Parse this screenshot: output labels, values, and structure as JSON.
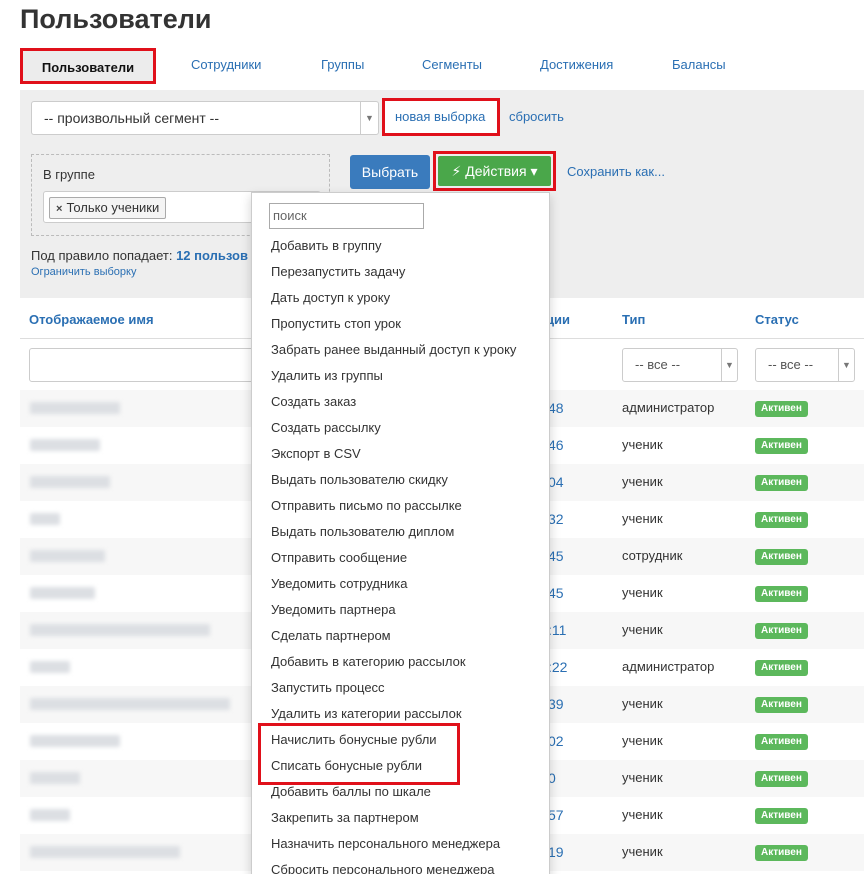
{
  "page": {
    "title": "Пользователи"
  },
  "tabs": [
    "Пользователи",
    "Сотрудники",
    "Группы",
    "Сегменты",
    "Достижения",
    "Балансы"
  ],
  "filter": {
    "segment_value": "-- произвольный сегмент --",
    "new_selection": "новая выборка",
    "reset": "сбросить",
    "group_label": "В группе",
    "group_tag": "Только ученики",
    "choose_button": "Выбрать",
    "actions_button": "Действия",
    "save_as": "Сохранить как...",
    "count_prefix": "Под правило попадает:",
    "count_value": "12 пользов",
    "limit": "Ограничить выборку"
  },
  "columns": {
    "name": "Отображаемое имя",
    "id_partial": "ции",
    "type": "Тип",
    "status": "Статус",
    "type_filter": "-- все --",
    "status_filter": "-- все --"
  },
  "rows": [
    {
      "id": "48",
      "type": "администратор",
      "status": "Активен"
    },
    {
      "id": "46",
      "type": "ученик",
      "status": "Активен"
    },
    {
      "id": "04",
      "type": "ученик",
      "status": "Активен"
    },
    {
      "id": "32",
      "type": "ученик",
      "status": "Активен"
    },
    {
      "id": "45",
      "type": "сотрудник",
      "status": "Активен"
    },
    {
      "id": "45",
      "type": "ученик",
      "status": "Активен"
    },
    {
      "id": ":11",
      "type": "ученик",
      "status": "Активен"
    },
    {
      "id": ":22",
      "type": "администратор",
      "status": "Активен"
    },
    {
      "id": "39",
      "type": "ученик",
      "status": "Активен"
    },
    {
      "id": "02",
      "type": "ученик",
      "status": "Активен"
    },
    {
      "id": "0",
      "type": "ученик",
      "status": "Активен"
    },
    {
      "id": "57",
      "type": "ученик",
      "status": "Активен"
    },
    {
      "id": "19",
      "type": "ученик",
      "status": "Активен"
    }
  ],
  "dropdown": {
    "search_placeholder": "поиск",
    "items": [
      "Добавить в группу",
      "Перезапустить задачу",
      "Дать доступ к уроку",
      "Пропустить стоп урок",
      "Забрать ранее выданный доступ к уроку",
      "Удалить из группы",
      "Создать заказ",
      "Создать рассылку",
      "Экспорт в CSV",
      "Выдать пользователю скидку",
      "Отправить письмо по рассылке",
      "Выдать пользователю диплом",
      "Отправить сообщение",
      "Уведомить сотрудника",
      "Уведомить партнера",
      "Сделать партнером",
      "Добавить в категорию рассылок",
      "Запустить процесс",
      "Удалить из категории рассылок",
      "Начислить бонусные рубли",
      "Списать бонусные рубли",
      "Добавить баллы по шкале",
      "Закрепить за партнером",
      "Назначить персонального менеджера",
      "Сбросить персонального менеджера"
    ]
  }
}
